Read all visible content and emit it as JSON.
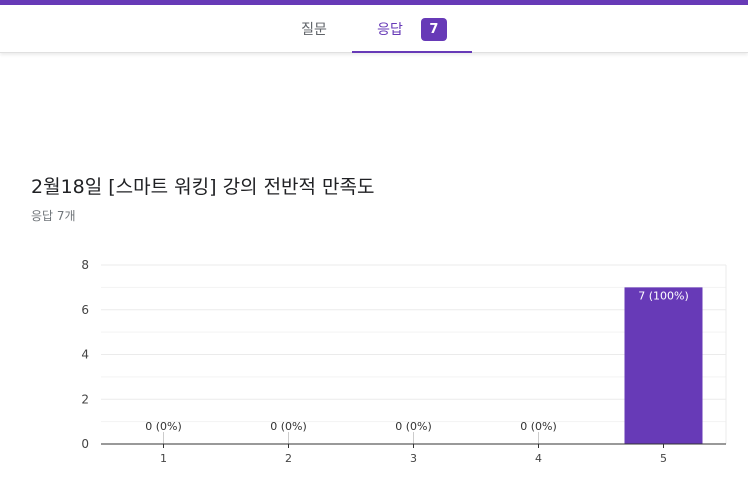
{
  "tabs": {
    "questions_label": "질문",
    "responses_label": "응답",
    "responses_count": "7"
  },
  "question": {
    "title": "2월18일 [스마트 워킹] 강의 전반적 만족도",
    "response_count": "응답 7개"
  },
  "colors": {
    "accent": "#673ab7",
    "bar": "#673ab7",
    "grid": "#ebebeb",
    "axis": "#333333"
  },
  "chart_data": {
    "type": "bar",
    "categories": [
      "1",
      "2",
      "3",
      "4",
      "5"
    ],
    "values": [
      0,
      0,
      0,
      0,
      7
    ],
    "data_labels": [
      "0 (0%)",
      "0 (0%)",
      "0 (0%)",
      "0 (0%)",
      "7 (100%)"
    ],
    "yticks": [
      0,
      2,
      4,
      6,
      8
    ],
    "ylim": [
      0,
      8
    ],
    "grid": true,
    "legend": "none"
  }
}
